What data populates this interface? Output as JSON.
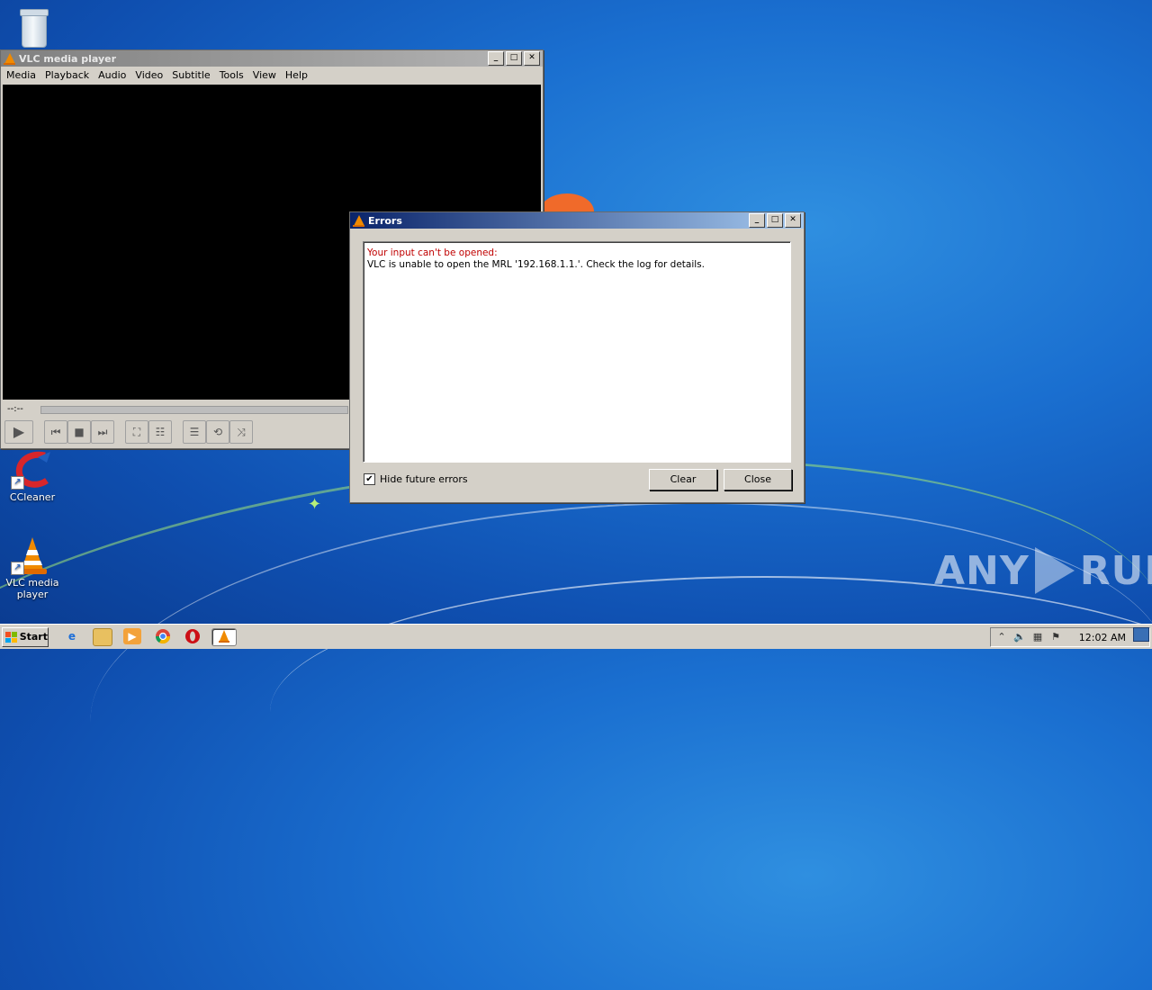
{
  "desktop": {
    "icons": [
      {
        "label": "",
        "icon": "recycle-bin-icon"
      },
      {
        "label": "CCleaner",
        "icon": "ccleaner-icon"
      },
      {
        "label": "VLC media player",
        "icon": "vlc-cone-icon"
      }
    ],
    "watermark": {
      "left": "ANY",
      "right": "RUN"
    }
  },
  "vlc_window": {
    "title": "VLC media player",
    "menu": [
      "Media",
      "Playback",
      "Audio",
      "Video",
      "Subtitle",
      "Tools",
      "View",
      "Help"
    ],
    "time": "--:--"
  },
  "errors_dialog": {
    "title": "Errors",
    "error_heading": "Your input can't be opened:",
    "error_detail": "VLC is unable to open the MRL '192.168.1.1.'. Check the log for details.",
    "hide_future_errors_label": "Hide future errors",
    "hide_future_errors_checked": true,
    "clear_label": "Clear",
    "close_label": "Close"
  },
  "taskbar": {
    "start_label": "Start",
    "clock": "12:02 AM"
  },
  "colors": {
    "error_red": "#c00000",
    "vlc_orange": "#f08a00",
    "active_title_start": "#0a246a",
    "active_title_end": "#a6caf0"
  }
}
